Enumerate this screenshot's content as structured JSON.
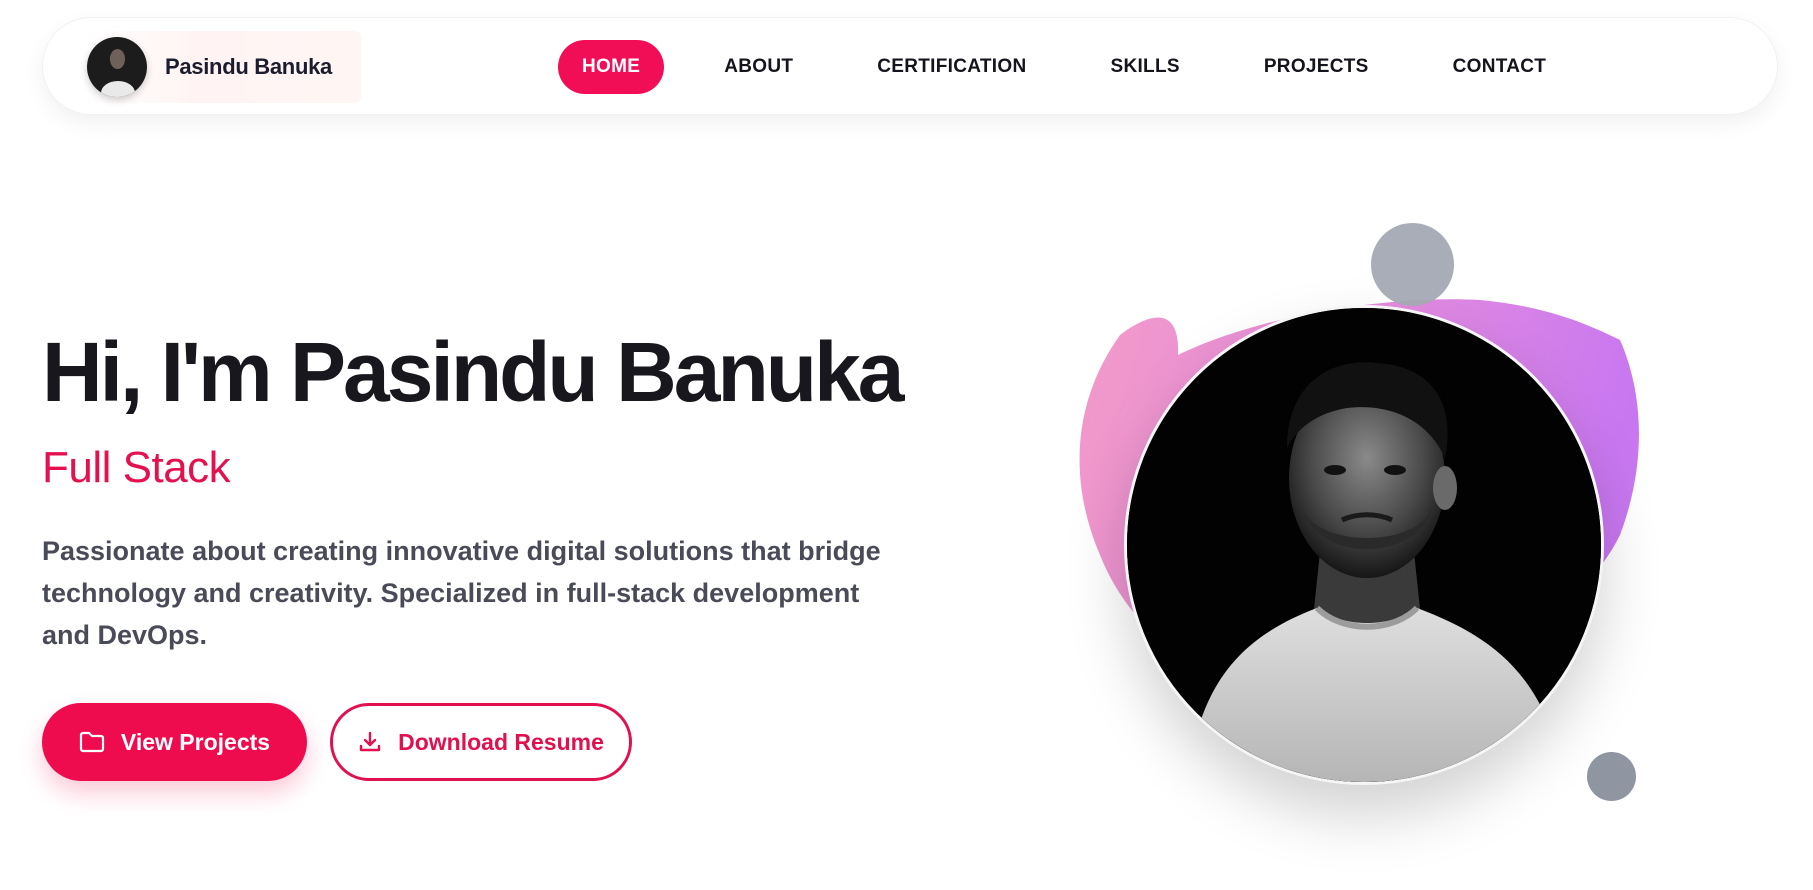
{
  "brand": {
    "name": "Pasindu Banuka"
  },
  "nav": {
    "items": [
      {
        "label": "HOME",
        "active": true
      },
      {
        "label": "ABOUT"
      },
      {
        "label": "CERTIFICATION"
      },
      {
        "label": "SKILLS"
      },
      {
        "label": "PROJECTS"
      },
      {
        "label": "CONTACT"
      }
    ]
  },
  "hero": {
    "title": "Hi, I'm Pasindu Banuka",
    "role": "Full Stack",
    "description": "Passionate about creating innovative digital solutions that bridge technology and creativity. Specialized in full-stack development and DevOps.",
    "primary_button": {
      "label": "View Projects",
      "icon": "folder-icon"
    },
    "secondary_button": {
      "label": "Download Resume",
      "icon": "download-icon"
    }
  },
  "colors": {
    "accent": "#ee0c4f",
    "text_dark": "#17171d",
    "blob_pink": "#f39ac8",
    "blob_purple": "#c877f0",
    "gray_dot": "#a3a9b3"
  }
}
